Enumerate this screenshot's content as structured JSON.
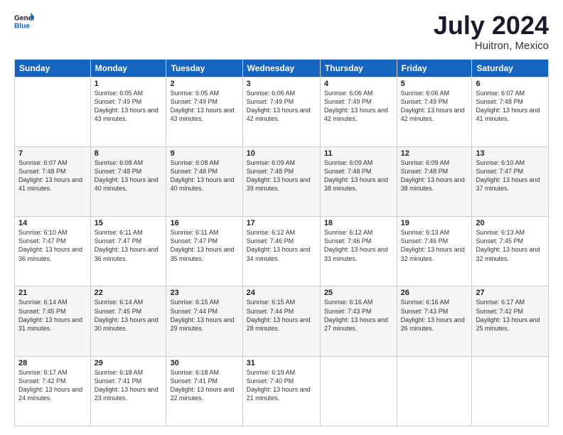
{
  "logo": {
    "line1": "General",
    "line2": "Blue"
  },
  "title": "July 2024",
  "subtitle": "Huitron, Mexico",
  "headers": [
    "Sunday",
    "Monday",
    "Tuesday",
    "Wednesday",
    "Thursday",
    "Friday",
    "Saturday"
  ],
  "weeks": [
    [
      {
        "day": "",
        "sunrise": "",
        "sunset": "",
        "daylight": ""
      },
      {
        "day": "1",
        "sunrise": "Sunrise: 6:05 AM",
        "sunset": "Sunset: 7:49 PM",
        "daylight": "Daylight: 13 hours and 43 minutes."
      },
      {
        "day": "2",
        "sunrise": "Sunrise: 6:05 AM",
        "sunset": "Sunset: 7:49 PM",
        "daylight": "Daylight: 13 hours and 43 minutes."
      },
      {
        "day": "3",
        "sunrise": "Sunrise: 6:06 AM",
        "sunset": "Sunset: 7:49 PM",
        "daylight": "Daylight: 13 hours and 42 minutes."
      },
      {
        "day": "4",
        "sunrise": "Sunrise: 6:06 AM",
        "sunset": "Sunset: 7:49 PM",
        "daylight": "Daylight: 13 hours and 42 minutes."
      },
      {
        "day": "5",
        "sunrise": "Sunrise: 6:06 AM",
        "sunset": "Sunset: 7:49 PM",
        "daylight": "Daylight: 13 hours and 42 minutes."
      },
      {
        "day": "6",
        "sunrise": "Sunrise: 6:07 AM",
        "sunset": "Sunset: 7:48 PM",
        "daylight": "Daylight: 13 hours and 41 minutes."
      }
    ],
    [
      {
        "day": "7",
        "sunrise": "Sunrise: 6:07 AM",
        "sunset": "Sunset: 7:48 PM",
        "daylight": "Daylight: 13 hours and 41 minutes."
      },
      {
        "day": "8",
        "sunrise": "Sunrise: 6:08 AM",
        "sunset": "Sunset: 7:48 PM",
        "daylight": "Daylight: 13 hours and 40 minutes."
      },
      {
        "day": "9",
        "sunrise": "Sunrise: 6:08 AM",
        "sunset": "Sunset: 7:48 PM",
        "daylight": "Daylight: 13 hours and 40 minutes."
      },
      {
        "day": "10",
        "sunrise": "Sunrise: 6:09 AM",
        "sunset": "Sunset: 7:48 PM",
        "daylight": "Daylight: 13 hours and 39 minutes."
      },
      {
        "day": "11",
        "sunrise": "Sunrise: 6:09 AM",
        "sunset": "Sunset: 7:48 PM",
        "daylight": "Daylight: 13 hours and 38 minutes."
      },
      {
        "day": "12",
        "sunrise": "Sunrise: 6:09 AM",
        "sunset": "Sunset: 7:48 PM",
        "daylight": "Daylight: 13 hours and 38 minutes."
      },
      {
        "day": "13",
        "sunrise": "Sunrise: 6:10 AM",
        "sunset": "Sunset: 7:47 PM",
        "daylight": "Daylight: 13 hours and 37 minutes."
      }
    ],
    [
      {
        "day": "14",
        "sunrise": "Sunrise: 6:10 AM",
        "sunset": "Sunset: 7:47 PM",
        "daylight": "Daylight: 13 hours and 36 minutes."
      },
      {
        "day": "15",
        "sunrise": "Sunrise: 6:11 AM",
        "sunset": "Sunset: 7:47 PM",
        "daylight": "Daylight: 13 hours and 36 minutes."
      },
      {
        "day": "16",
        "sunrise": "Sunrise: 6:11 AM",
        "sunset": "Sunset: 7:47 PM",
        "daylight": "Daylight: 13 hours and 35 minutes."
      },
      {
        "day": "17",
        "sunrise": "Sunrise: 6:12 AM",
        "sunset": "Sunset: 7:46 PM",
        "daylight": "Daylight: 13 hours and 34 minutes."
      },
      {
        "day": "18",
        "sunrise": "Sunrise: 6:12 AM",
        "sunset": "Sunset: 7:46 PM",
        "daylight": "Daylight: 13 hours and 33 minutes."
      },
      {
        "day": "19",
        "sunrise": "Sunrise: 6:13 AM",
        "sunset": "Sunset: 7:46 PM",
        "daylight": "Daylight: 13 hours and 32 minutes."
      },
      {
        "day": "20",
        "sunrise": "Sunrise: 6:13 AM",
        "sunset": "Sunset: 7:45 PM",
        "daylight": "Daylight: 13 hours and 32 minutes."
      }
    ],
    [
      {
        "day": "21",
        "sunrise": "Sunrise: 6:14 AM",
        "sunset": "Sunset: 7:45 PM",
        "daylight": "Daylight: 13 hours and 31 minutes."
      },
      {
        "day": "22",
        "sunrise": "Sunrise: 6:14 AM",
        "sunset": "Sunset: 7:45 PM",
        "daylight": "Daylight: 13 hours and 30 minutes."
      },
      {
        "day": "23",
        "sunrise": "Sunrise: 6:15 AM",
        "sunset": "Sunset: 7:44 PM",
        "daylight": "Daylight: 13 hours and 29 minutes."
      },
      {
        "day": "24",
        "sunrise": "Sunrise: 6:15 AM",
        "sunset": "Sunset: 7:44 PM",
        "daylight": "Daylight: 13 hours and 28 minutes."
      },
      {
        "day": "25",
        "sunrise": "Sunrise: 6:16 AM",
        "sunset": "Sunset: 7:43 PM",
        "daylight": "Daylight: 13 hours and 27 minutes."
      },
      {
        "day": "26",
        "sunrise": "Sunrise: 6:16 AM",
        "sunset": "Sunset: 7:43 PM",
        "daylight": "Daylight: 13 hours and 26 minutes."
      },
      {
        "day": "27",
        "sunrise": "Sunrise: 6:17 AM",
        "sunset": "Sunset: 7:42 PM",
        "daylight": "Daylight: 13 hours and 25 minutes."
      }
    ],
    [
      {
        "day": "28",
        "sunrise": "Sunrise: 6:17 AM",
        "sunset": "Sunset: 7:42 PM",
        "daylight": "Daylight: 13 hours and 24 minutes."
      },
      {
        "day": "29",
        "sunrise": "Sunrise: 6:18 AM",
        "sunset": "Sunset: 7:41 PM",
        "daylight": "Daylight: 13 hours and 23 minutes."
      },
      {
        "day": "30",
        "sunrise": "Sunrise: 6:18 AM",
        "sunset": "Sunset: 7:41 PM",
        "daylight": "Daylight: 13 hours and 22 minutes."
      },
      {
        "day": "31",
        "sunrise": "Sunrise: 6:19 AM",
        "sunset": "Sunset: 7:40 PM",
        "daylight": "Daylight: 13 hours and 21 minutes."
      },
      {
        "day": "",
        "sunrise": "",
        "sunset": "",
        "daylight": ""
      },
      {
        "day": "",
        "sunrise": "",
        "sunset": "",
        "daylight": ""
      },
      {
        "day": "",
        "sunrise": "",
        "sunset": "",
        "daylight": ""
      }
    ]
  ]
}
